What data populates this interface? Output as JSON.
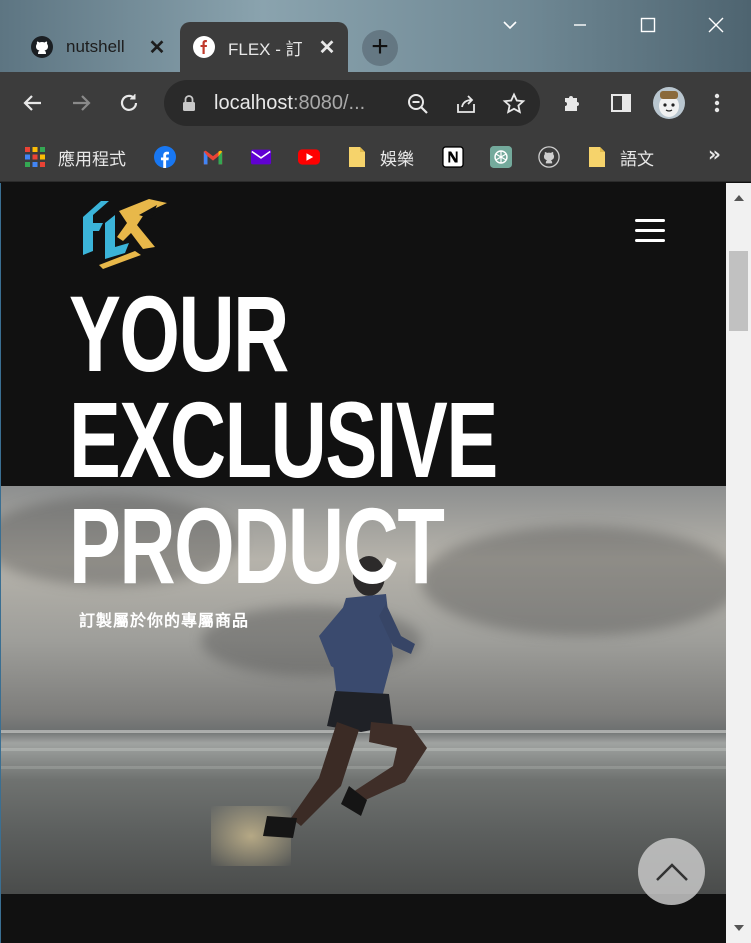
{
  "browser": {
    "tabs": [
      {
        "title": "nutshell",
        "icon": "github-icon",
        "active": false
      },
      {
        "title": "FLEX - 訂",
        "icon": "flex-favicon-icon",
        "active": true
      }
    ],
    "new_tab_symbol": "+",
    "close_symbol": "✕",
    "url_host": "localhost",
    "url_rest": ":8080/...",
    "bookmarks": [
      {
        "label": "應用程式",
        "icon": "apps-grid-icon"
      },
      {
        "label": "",
        "icon": "facebook-icon"
      },
      {
        "label": "",
        "icon": "gmail-icon"
      },
      {
        "label": "",
        "icon": "yahoo-mail-icon"
      },
      {
        "label": "",
        "icon": "youtube-icon"
      },
      {
        "label": "娛樂",
        "icon": "folder-icon"
      },
      {
        "label": "",
        "icon": "notion-icon"
      },
      {
        "label": "",
        "icon": "chatgpt-icon"
      },
      {
        "label": "",
        "icon": "github-icon"
      },
      {
        "label": "語文",
        "icon": "folder-icon"
      }
    ],
    "bookmarks_overflow": "»"
  },
  "page": {
    "hero": {
      "title_lines": [
        "YOUR",
        "EXCLUSIVE",
        "PRODUCT"
      ],
      "subtitle": "訂製屬於你的專屬商品"
    },
    "colors": {
      "background": "#111111",
      "logo_blue": "#3bb4d9",
      "logo_gold": "#e8b84a"
    }
  }
}
